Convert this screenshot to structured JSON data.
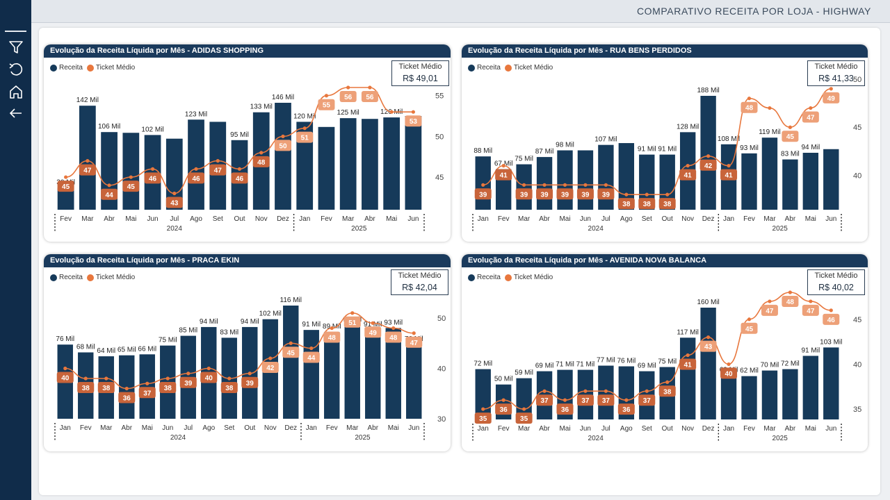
{
  "report_title": "COMPARATIVO RECEITA POR LOJA - HIGHWAY",
  "nav": [
    {
      "name": "filter-icon"
    },
    {
      "name": "reset-icon"
    },
    {
      "name": "home-icon"
    },
    {
      "name": "back-arrow-icon"
    }
  ],
  "colors": {
    "receita": "#163a5a",
    "ticket": "#e8773d",
    "ticket_label_bg": "#c8643a",
    "ticket_label_bg_light": "#eda078"
  },
  "legend": {
    "receita": "Receita",
    "ticket": "Ticket Médio"
  },
  "kpi_label": "Ticket Médio",
  "chart_data": [
    {
      "type": "bar+line",
      "title": "Evolução da Receita Líquida por Mês - ADIDAS SHOPPING",
      "ticket_medio_kpi": "R$ 49,01",
      "categories": [
        "Fev",
        "Mar",
        "Abr",
        "Mai",
        "Jun",
        "Jul",
        "Ago",
        "Set",
        "Out",
        "Nov",
        "Dez",
        "Jan",
        "Fev",
        "Mar",
        "Abr",
        "Mai",
        "Jun"
      ],
      "years": [
        {
          "label": "2024",
          "from": 0,
          "to": 10
        },
        {
          "label": "2025",
          "from": 11,
          "to": 16
        }
      ],
      "bar_max": 146,
      "receita": [
        30,
        142,
        106,
        105,
        102,
        97,
        123,
        120,
        95,
        133,
        146,
        120,
        113,
        125,
        124,
        126,
        128
      ],
      "receita_labels": [
        "30 Mil",
        "142 Mil",
        "106 Mil",
        "",
        "102 Mil",
        "",
        "123 Mil",
        "",
        "95 Mil",
        "133 Mil",
        "146 Mil",
        "120 Mil",
        "",
        "125 Mil",
        "",
        "126 Mil",
        ""
      ],
      "ticket": [
        45,
        47,
        44,
        45,
        46,
        43,
        46,
        47,
        46,
        48,
        50,
        51,
        55,
        56,
        56,
        53,
        53
      ],
      "ticket_labels": [
        "45",
        "47",
        "44",
        "45",
        "46",
        "43",
        "46",
        "47",
        "46",
        "48",
        "50",
        "51",
        "55",
        "56",
        "56",
        "",
        "53"
      ],
      "line_ylim": [
        41,
        56
      ],
      "y2_ticks": [
        45,
        50,
        55
      ]
    },
    {
      "type": "bar+line",
      "title": "Evolução da Receita Líquida por Mês - RUA BENS PERDIDOS",
      "ticket_medio_kpi": "R$ 41,33",
      "categories": [
        "Jan",
        "Fev",
        "Mar",
        "Abr",
        "Mai",
        "Jun",
        "Jul",
        "Ago",
        "Set",
        "Out",
        "Nov",
        "Dez",
        "Jan",
        "Fev",
        "Mar",
        "Abr",
        "Mai",
        "Jun"
      ],
      "years": [
        {
          "label": "2024",
          "from": 0,
          "to": 11
        },
        {
          "label": "2025",
          "from": 12,
          "to": 17
        }
      ],
      "bar_max": 188,
      "receita": [
        88,
        67,
        75,
        87,
        98,
        98,
        107,
        110,
        91,
        91,
        128,
        188,
        108,
        93,
        119,
        83,
        94,
        100
      ],
      "receita_labels": [
        "88 Mil",
        "67 Mil",
        "75 Mil",
        "87 Mil",
        "98 Mil",
        "",
        "107 Mil",
        "",
        "91 Mil",
        "91 Mil",
        "128 Mil",
        "188 Mil",
        "108 Mil",
        "93 Mil",
        "119 Mil",
        "83 Mil",
        "94 Mil",
        ""
      ],
      "ticket": [
        39,
        41,
        39,
        39,
        39,
        39,
        39,
        38,
        38,
        38,
        41,
        42,
        41,
        48,
        47,
        45,
        47,
        49
      ],
      "ticket_labels": [
        "39",
        "41",
        "39",
        "39",
        "39",
        "39",
        "39",
        "38",
        "38",
        "38",
        "41",
        "42",
        "41",
        "48",
        "",
        "45",
        "47",
        "49"
      ],
      "line_ylim": [
        37,
        50
      ],
      "y2_ticks": [
        40,
        45,
        50
      ]
    },
    {
      "type": "bar+line",
      "title": "Evolução da Receita Líquida por Mês - PRACA EKIN",
      "ticket_medio_kpi": "R$ 42,04",
      "categories": [
        "Jan",
        "Fev",
        "Mar",
        "Abr",
        "Mai",
        "Jun",
        "Jul",
        "Ago",
        "Set",
        "Out",
        "Nov",
        "Dez",
        "Jan",
        "Fev",
        "Mar",
        "Abr",
        "Mai",
        "Jun"
      ],
      "years": [
        {
          "label": "2024",
          "from": 0,
          "to": 11
        },
        {
          "label": "2025",
          "from": 12,
          "to": 17
        }
      ],
      "bar_max": 116,
      "receita": [
        76,
        68,
        64,
        65,
        66,
        75,
        85,
        94,
        83,
        94,
        102,
        116,
        91,
        89,
        96,
        91,
        93,
        76
      ],
      "receita_labels": [
        "76 Mil",
        "68 Mil",
        "64 Mil",
        "65 Mil",
        "66 Mil",
        "75 Mil",
        "85 Mil",
        "94 Mil",
        "83 Mil",
        "94 Mil",
        "102 Mil",
        "116 Mil",
        "91 Mil",
        "89 Mil",
        "96 Mil",
        "91 Mil",
        "93 Mil",
        "76 Mil"
      ],
      "ticket": [
        40,
        38,
        38,
        36,
        37,
        38,
        39,
        40,
        38,
        39,
        42,
        45,
        44,
        48,
        51,
        49,
        48,
        47
      ],
      "ticket_labels": [
        "40",
        "38",
        "38",
        "36",
        "37",
        "38",
        "39",
        "40",
        "38",
        "39",
        "42",
        "45",
        "44",
        "48",
        "51",
        "49",
        "48",
        "47"
      ],
      "line_ylim": [
        30,
        50
      ],
      "y2_ticks": [
        30,
        40,
        50
      ]
    },
    {
      "type": "bar+line",
      "title": "Evolução da Receita Líquida por Mês - AVENIDA NOVA BALANCA",
      "ticket_medio_kpi": "R$ 40,02",
      "categories": [
        "Jan",
        "Fev",
        "Mar",
        "Abr",
        "Mai",
        "Jun",
        "Jul",
        "Ago",
        "Set",
        "Out",
        "Nov",
        "Dez",
        "Jan",
        "Fev",
        "Mar",
        "Abr",
        "Mai",
        "Jun"
      ],
      "years": [
        {
          "label": "2024",
          "from": 0,
          "to": 11
        },
        {
          "label": "2025",
          "from": 12,
          "to": 17
        }
      ],
      "bar_max": 160,
      "receita": [
        72,
        50,
        59,
        69,
        71,
        71,
        77,
        76,
        69,
        75,
        117,
        160,
        63,
        62,
        70,
        72,
        91,
        103
      ],
      "receita_labels": [
        "72 Mil",
        "50 Mil",
        "59 Mil",
        "69 Mil",
        "71 Mil",
        "71 Mil",
        "77 Mil",
        "76 Mil",
        "69 Mil",
        "75 Mil",
        "117 Mil",
        "160 Mil",
        "63 Mil",
        "62 Mil",
        "70 Mil",
        "72 Mil",
        "91 Mil",
        "103 Mil"
      ],
      "ticket": [
        35,
        36,
        35,
        37,
        36,
        37,
        37,
        36,
        37,
        38,
        41,
        43,
        40,
        45,
        47,
        48,
        47,
        46
      ],
      "ticket_labels": [
        "35",
        "36",
        "35",
        "37",
        "36",
        "37",
        "37",
        "36",
        "37",
        "38",
        "41",
        "43",
        "40",
        "45",
        "47",
        "48",
        "47",
        "46"
      ],
      "line_ylim": [
        34,
        48
      ],
      "y2_ticks": [
        35,
        40,
        45
      ]
    }
  ]
}
